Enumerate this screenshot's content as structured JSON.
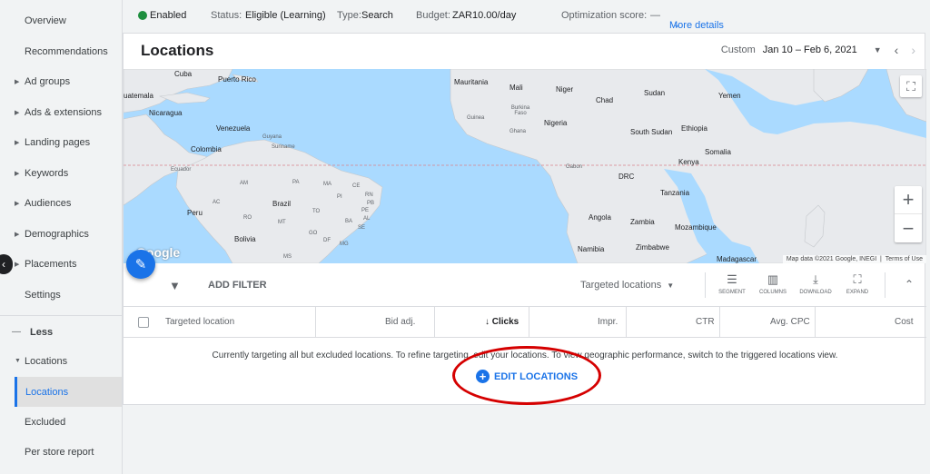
{
  "sidebar": {
    "items": [
      {
        "label": "Overview",
        "arrow": false
      },
      {
        "label": "Recommendations",
        "arrow": false
      },
      {
        "label": "Ad groups",
        "arrow": true
      },
      {
        "label": "Ads & extensions",
        "arrow": true
      },
      {
        "label": "Landing pages",
        "arrow": true
      },
      {
        "label": "Keywords",
        "arrow": true
      },
      {
        "label": "Audiences",
        "arrow": true
      },
      {
        "label": "Demographics",
        "arrow": true
      },
      {
        "label": "Placements",
        "arrow": true
      },
      {
        "label": "Settings",
        "arrow": false
      }
    ],
    "less_label": "Less",
    "section_label": "Locations",
    "sub_items": [
      "Locations",
      "Excluded",
      "Per store report"
    ]
  },
  "status_bar": {
    "enabled": "Enabled",
    "status_prefix": "Status:",
    "status_value": "Eligible (Learning)",
    "type_prefix": "Type:",
    "type_value": "Search",
    "budget_prefix": "Budget:",
    "budget_value": "ZAR10.00/day",
    "optimization_label": "Optimization score:",
    "optimization_value": "—",
    "more_details": "More details"
  },
  "page": {
    "title": "Locations",
    "date_custom": "Custom",
    "date_range": "Jan 10 – Feb 6, 2021"
  },
  "map": {
    "labels": [
      "Puerto Rico",
      "Cuba",
      "uatemala",
      "Nicaragua",
      "Venezuela",
      "Guyana",
      "Suriname",
      "Colombia",
      "Ecuador",
      "Peru",
      "Brazil",
      "Bolivia",
      "Mauritania",
      "Mali",
      "Niger",
      "Chad",
      "Sudan",
      "Yemen",
      "Guinea",
      "Burkina Faso",
      "Ghana",
      "Nigeria",
      "South Sudan",
      "Ethiopia",
      "Somalia",
      "Gabon",
      "DRC",
      "Kenya",
      "Tanzania",
      "Angola",
      "Zambia",
      "Mozambique",
      "Namibia",
      "Zimbabwe",
      "Madagascar"
    ],
    "small_labels": [
      "AM",
      "PA",
      "MA",
      "CE",
      "PI",
      "RN",
      "PB",
      "PE",
      "AC",
      "RO",
      "TO",
      "AL",
      "SE",
      "BA",
      "MT",
      "GO",
      "DF",
      "MG",
      "MS"
    ],
    "logo": "Google",
    "attribution": "Map data ©2021 Google, INEGI",
    "terms": "Terms of Use"
  },
  "toolbar": {
    "add_filter": "ADD FILTER",
    "view_select": "Targeted locations",
    "tools": [
      "SEGMENT",
      "COLUMNS",
      "DOWNLOAD",
      "EXPAND"
    ]
  },
  "table": {
    "headers": [
      "Targeted location",
      "Bid adj.",
      "Clicks",
      "Impr.",
      "CTR",
      "Avg. CPC",
      "Cost"
    ]
  },
  "empty_state": {
    "message": "Currently targeting all but excluded locations. To refine targeting, edit your locations. To view geographic performance, switch to the triggered locations view.",
    "edit_button": "EDIT LOCATIONS"
  }
}
